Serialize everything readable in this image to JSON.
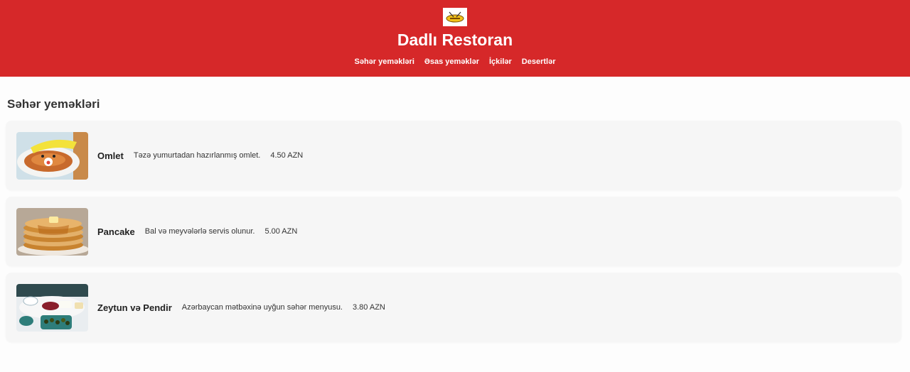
{
  "header": {
    "title": "Dadlı Restoran",
    "logo_icon": "restaurant-logo-icon",
    "background": "#d62829"
  },
  "nav": {
    "items": [
      {
        "label": "Səhər yeməkləri"
      },
      {
        "label": "Əsas yeməklər"
      },
      {
        "label": "İçkilər"
      },
      {
        "label": "Desertlər"
      }
    ]
  },
  "section": {
    "title": "Səhər yeməkləri",
    "items": [
      {
        "name": "Omlet",
        "description": "Təzə yumurtadan hazırlanmış omlet.",
        "price": "4.50 AZN",
        "image": "omelet-photo"
      },
      {
        "name": "Pancake",
        "description": "Bal və meyvələrlə servis olunur.",
        "price": "5.00 AZN",
        "image": "pancake-photo"
      },
      {
        "name": "Zeytun və Pendir",
        "description": "Azərbaycan mətbəxinə uyğun səhər menyusu.",
        "price": "3.80 AZN",
        "image": "olives-and-cheese-photo"
      }
    ]
  }
}
